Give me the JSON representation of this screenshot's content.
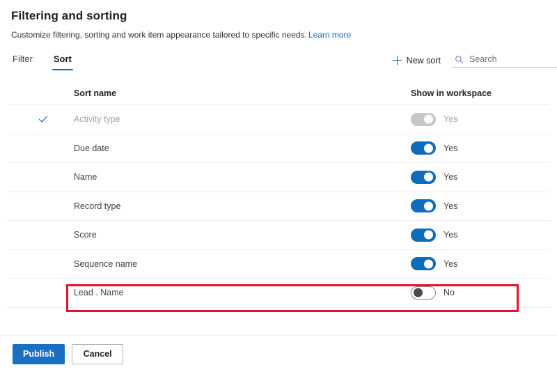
{
  "header": {
    "title": "Filtering and sorting",
    "subtitle": "Customize filtering, sorting and work item appearance tailored to specific needs.",
    "learn_more_label": "Learn more"
  },
  "command_bar": {
    "tabs": [
      {
        "label": "Filter",
        "active": false
      },
      {
        "label": "Sort",
        "active": true
      }
    ],
    "new_sort_label": "New sort",
    "plus_icon": "plus-icon",
    "search": {
      "icon": "search-icon",
      "placeholder": "Search",
      "value": ""
    }
  },
  "table": {
    "columns": {
      "name": "Sort name",
      "toggle": "Show in workspace"
    },
    "rows": [
      {
        "name": "Activity type",
        "checked": true,
        "disabled": true,
        "toggle_state": "disabled-on",
        "toggle_label": "Yes",
        "highlighted": false
      },
      {
        "name": "Due date",
        "checked": false,
        "disabled": false,
        "toggle_state": "on",
        "toggle_label": "Yes",
        "highlighted": false
      },
      {
        "name": "Name",
        "checked": false,
        "disabled": false,
        "toggle_state": "on",
        "toggle_label": "Yes",
        "highlighted": false
      },
      {
        "name": "Record type",
        "checked": false,
        "disabled": false,
        "toggle_state": "on",
        "toggle_label": "Yes",
        "highlighted": false
      },
      {
        "name": "Score",
        "checked": false,
        "disabled": false,
        "toggle_state": "on",
        "toggle_label": "Yes",
        "highlighted": false
      },
      {
        "name": "Sequence name",
        "checked": false,
        "disabled": false,
        "toggle_state": "on",
        "toggle_label": "Yes",
        "highlighted": false
      },
      {
        "name": "Lead . Name",
        "checked": false,
        "disabled": false,
        "toggle_state": "off",
        "toggle_label": "No",
        "highlighted": true
      }
    ]
  },
  "footer": {
    "publish_label": "Publish",
    "cancel_label": "Cancel"
  },
  "colors": {
    "accent": "#0f6cbd",
    "primary_button": "#1b6ec2",
    "link": "#0f6cbd",
    "highlight": "#e8112d",
    "toggle_on": "#0f6cbd",
    "toggle_disabled": "#c7c7c7"
  }
}
